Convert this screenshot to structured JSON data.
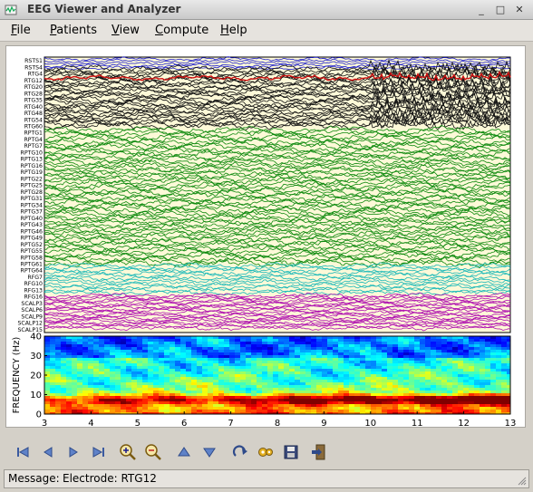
{
  "window": {
    "title": "EEG Viewer and Analyzer",
    "min_glyph": "_",
    "max_glyph": "□",
    "close_glyph": "✕"
  },
  "menu": [
    {
      "key": "F",
      "rest": "ile"
    },
    {
      "key": "P",
      "rest": "atients"
    },
    {
      "key": "V",
      "rest": "iew"
    },
    {
      "key": "C",
      "rest": "ompute"
    },
    {
      "key": "H",
      "rest": "elp"
    }
  ],
  "eeg": {
    "channel_labels": [
      "RSTS1",
      "RSTS4",
      "RTG4",
      "RTG12",
      "RTG20",
      "RTG28",
      "RTG35",
      "RTG40",
      "RTG48",
      "RTG54",
      "RTG60",
      "RPTG1",
      "RPTG4",
      "RPTG7",
      "RPTG10",
      "RPTG13",
      "RPTG16",
      "RPTG19",
      "RPTG22",
      "RPTG25",
      "RPTG28",
      "RPTG31",
      "RPTG34",
      "RPTG37",
      "RPTG40",
      "RPTG43",
      "RPTG46",
      "RPTG49",
      "RPTG52",
      "RPTG55",
      "RPTG58",
      "RPTG61",
      "RPTG64",
      "RFG7",
      "RFG10",
      "RFG13",
      "RFG16",
      "SCALP3",
      "SCALP6",
      "SCALP9",
      "SCALP12",
      "SCALP15"
    ],
    "group_colors": {
      "blue": "#1a1acc",
      "black": "#111111",
      "red": "#d01010",
      "green": "#0e8a0e",
      "cyan": "#17b8b8",
      "magenta": "#b012b0"
    },
    "background": "#fdf9d8"
  },
  "spectrogram": {
    "ylabel": "FREQUENCY (Hz)",
    "y_ticks": [
      "0",
      "10",
      "20",
      "30",
      "40"
    ],
    "x_ticks": [
      "3",
      "4",
      "5",
      "6",
      "7",
      "8",
      "9",
      "10",
      "11",
      "12",
      "13"
    ]
  },
  "toolbar": {
    "icons": [
      "first-page-icon",
      "prev-page-icon",
      "next-page-icon",
      "last-page-icon",
      "zoom-in-icon",
      "zoom-out-icon",
      "scroll-up-icon",
      "scroll-down-icon",
      "reload-icon",
      "tape-icon",
      "save-icon",
      "exit-icon"
    ]
  },
  "status": {
    "prefix": "Message:",
    "text": "Electrode: RTG12"
  }
}
